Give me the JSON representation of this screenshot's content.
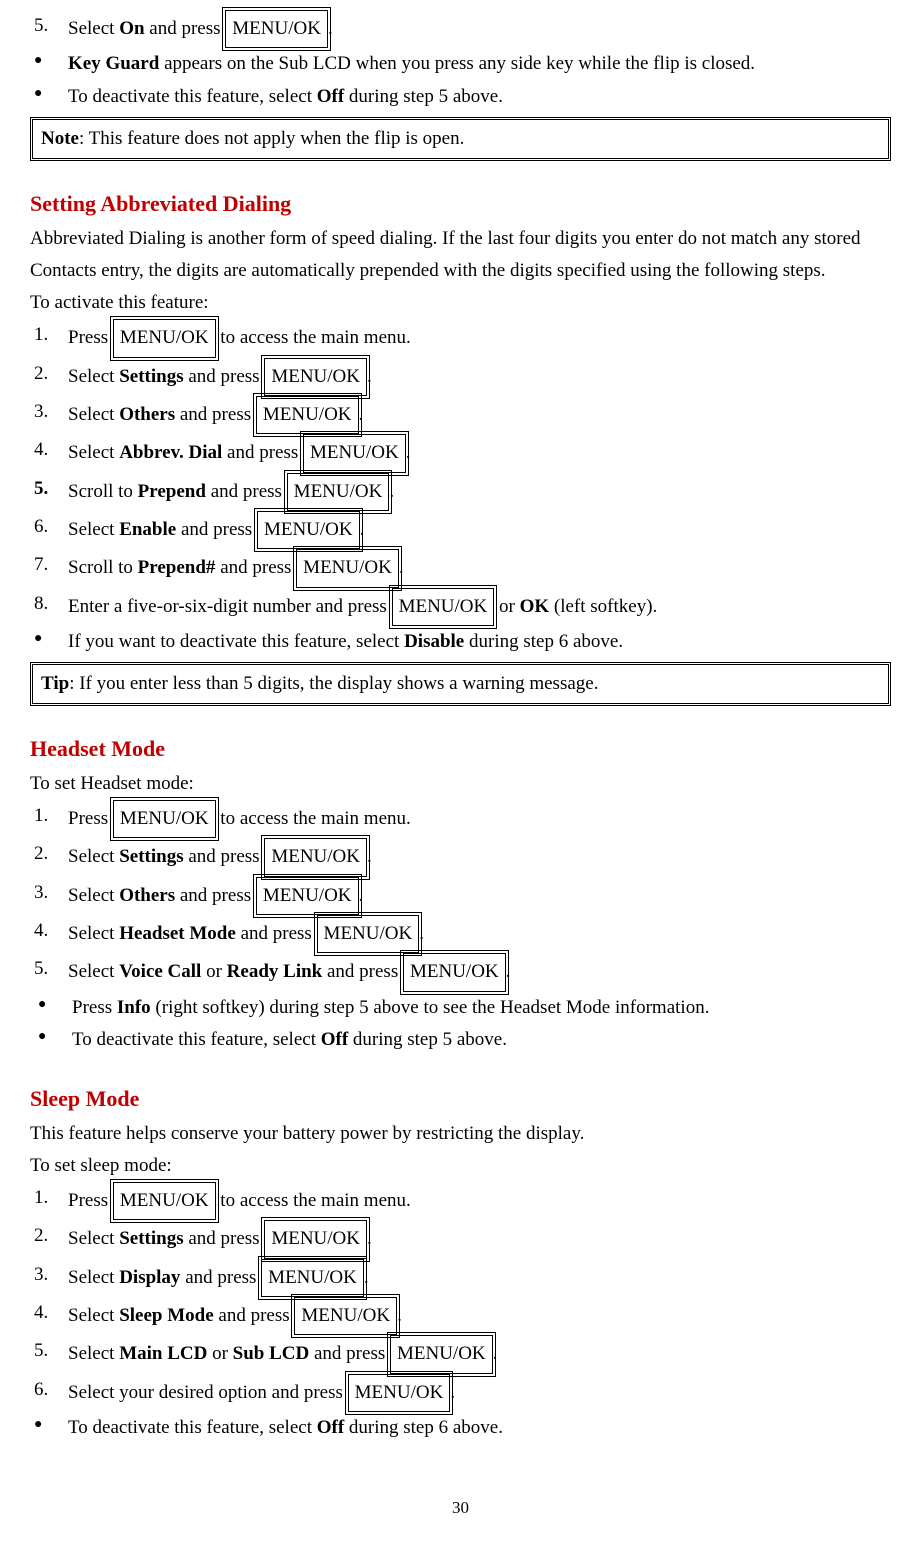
{
  "top": {
    "step5_num": "5.",
    "step5_a": "Select ",
    "step5_b": "On",
    "step5_c": " and press ",
    "step5_d": "MENU/OK",
    "step5_e": ".",
    "bullet": "●",
    "b1_a": "Key Guard",
    "b1_b": " appears on the Sub LCD when you press any side key while the flip is closed.",
    "b2_a": "To deactivate this feature, select ",
    "b2_b": "Off",
    "b2_c": " during step 5 above.",
    "note_a": "Note",
    "note_b": ": This feature does not apply when the flip is open."
  },
  "abbrev": {
    "heading": "Setting Abbreviated Dialing",
    "desc": "Abbreviated Dialing is another form of speed dialing. If the last four digits you enter do not match any stored Contacts entry, the digits are automatically prepended with the digits specified using the following steps.",
    "lead": "To activate this feature:",
    "n1": "1.",
    "s1_a": "Press ",
    "s1_b": "MENU/OK",
    "s1_c": " to access the main menu.",
    "n2": "2.",
    "s2_a": "Select ",
    "s2_b": "Settings",
    "s2_c": " and press ",
    "s2_d": "MENU/OK",
    "s2_e": ".",
    "n3": "3.",
    "s3_b": "Others",
    "n4": "4.",
    "s4_b": "Abbrev. Dial",
    "n5": "5.",
    "s5_a": "Scroll to ",
    "s5_b": "Prepend",
    "n6": "6.",
    "s6_b": "Enable",
    "n7": "7.",
    "s7_b": "Prepend#",
    "n8": "8.",
    "s8_a": "Enter a five-or-six-digit number and press ",
    "s8_b": "MENU/OK",
    "s8_c": " or ",
    "s8_d": "OK",
    "s8_e": " (left softkey).",
    "b1_a": "If you want to deactivate this feature, select ",
    "b1_b": "Disable",
    "b1_c": " during step 6 above.",
    "tip_a": "Tip",
    "tip_b": ": If you enter less than 5 digits, the display shows a warning message."
  },
  "headset": {
    "heading": "Headset Mode",
    "lead": "To set Headset mode:",
    "n1": "1.",
    "n2": "2.",
    "n3": "3.",
    "n4": "4.",
    "s4_b": "Headset Mode",
    "n5": "5.",
    "s5_b": "Voice Call",
    "s5_or": " or ",
    "s5_c": "Ready Link",
    "b1_a": "Press ",
    "b1_b": "Info",
    "b1_c": " (right softkey) during step 5 above to see the Headset Mode information.",
    "b2_a": "To deactivate this feature, select ",
    "b2_b": "Off",
    "b2_c": " during step 5 above."
  },
  "sleep": {
    "heading": "Sleep Mode",
    "desc": "This feature helps conserve your battery power by restricting the display.",
    "lead": "To set sleep mode:",
    "n1": "1.",
    "n2": "2.",
    "n3": "3.",
    "s3_b": "Display",
    "n4": "4.",
    "s4_b": "Sleep Mode",
    "n5": "5.",
    "s5_b": "Main LCD",
    "s5_or": " or ",
    "s5_c": "Sub LCD",
    "n6": "6.",
    "s6_a": "Select your desired option and press ",
    "b1_a": "To deactivate this feature, select ",
    "b1_b": "Off",
    "b1_c": " during step 6 above."
  },
  "common": {
    "select": "Select ",
    "andpress": " and press ",
    "menuok": "MENU/OK",
    "period": ".",
    "press": "Press ",
    "accessmain": " to access the main menu.",
    "bullet": "●"
  },
  "page": "30"
}
